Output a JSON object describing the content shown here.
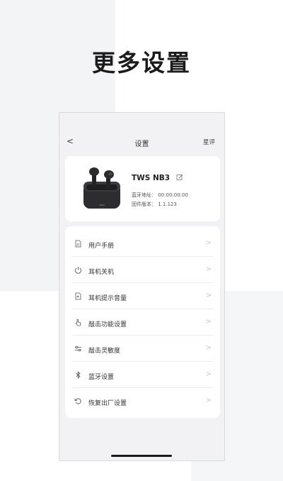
{
  "headline": "更多设置",
  "nav": {
    "back": "<",
    "title": "设置",
    "rate": "星评"
  },
  "device": {
    "name": "TWS NB3",
    "bluetooth_address_line": "蓝牙地址：  00:00:00:00",
    "firmware_line": "固件版本：  1.1.123"
  },
  "menu": [
    {
      "label": "用户手册",
      "icon": "document-icon"
    },
    {
      "label": "耳机关机",
      "icon": "power-icon"
    },
    {
      "label": "耳机提示音量",
      "icon": "volume-doc-icon"
    },
    {
      "label": "敲击功能设置",
      "icon": "tap-hand-icon"
    },
    {
      "label": "敲击灵敏度",
      "icon": "sliders-icon"
    },
    {
      "label": "蓝牙设置",
      "icon": "bluetooth-icon"
    },
    {
      "label": "恢复出厂设置",
      "icon": "reset-icon"
    }
  ],
  "chevron": ">"
}
